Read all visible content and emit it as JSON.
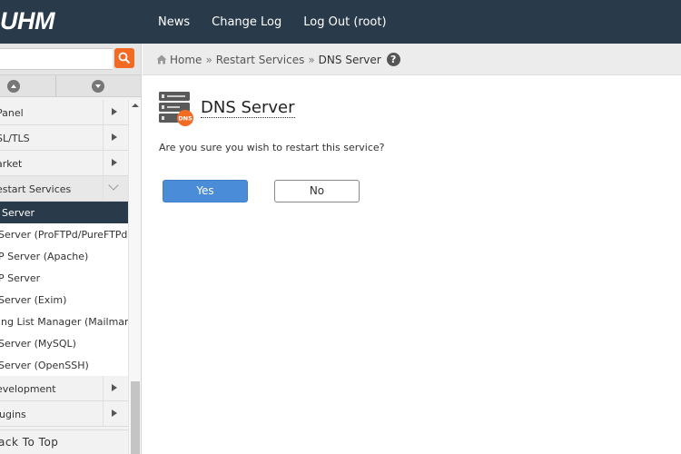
{
  "app": {
    "logo_text": "UHM"
  },
  "topnav": [
    {
      "label": "News"
    },
    {
      "label": "Change Log"
    },
    {
      "label": "Log Out (root)"
    }
  ],
  "sidebar": {
    "search": {
      "value": "",
      "placeholder": ""
    },
    "items": [
      {
        "label": "Panel",
        "state": "collapsed"
      },
      {
        "label": "SL/TLS",
        "state": "collapsed"
      },
      {
        "label": "arket",
        "state": "collapsed"
      },
      {
        "label": "estart Services",
        "state": "expanded"
      }
    ],
    "sub_items": [
      {
        "label": "Server",
        "active": true
      },
      {
        "label": "Server (ProFTPd/PureFTPd)"
      },
      {
        "label": "P Server (Apache)"
      },
      {
        "label": "P Server"
      },
      {
        "label": "Server (Exim)"
      },
      {
        "label": "ing List Manager (Mailman)"
      },
      {
        "label": "Server (MySQL)"
      },
      {
        "label": "Server (OpenSSH)"
      }
    ],
    "items_after": [
      {
        "label": "evelopment",
        "state": "collapsed"
      },
      {
        "label": "lugins",
        "state": "collapsed"
      }
    ],
    "back_to_top": "ack To Top"
  },
  "breadcrumb": {
    "home": "Home",
    "sep": "»",
    "parent": "Restart Services",
    "current": "DNS Server",
    "help": "?"
  },
  "main": {
    "title": "DNS Server",
    "icon_badge": "DNS",
    "question": "Are you sure you wish to restart this service?",
    "yes_label": "Yes",
    "no_label": "No"
  },
  "colors": {
    "topbar": "#293a4a",
    "accent_orange": "#f26b24",
    "primary_button": "#4a8cd8"
  }
}
